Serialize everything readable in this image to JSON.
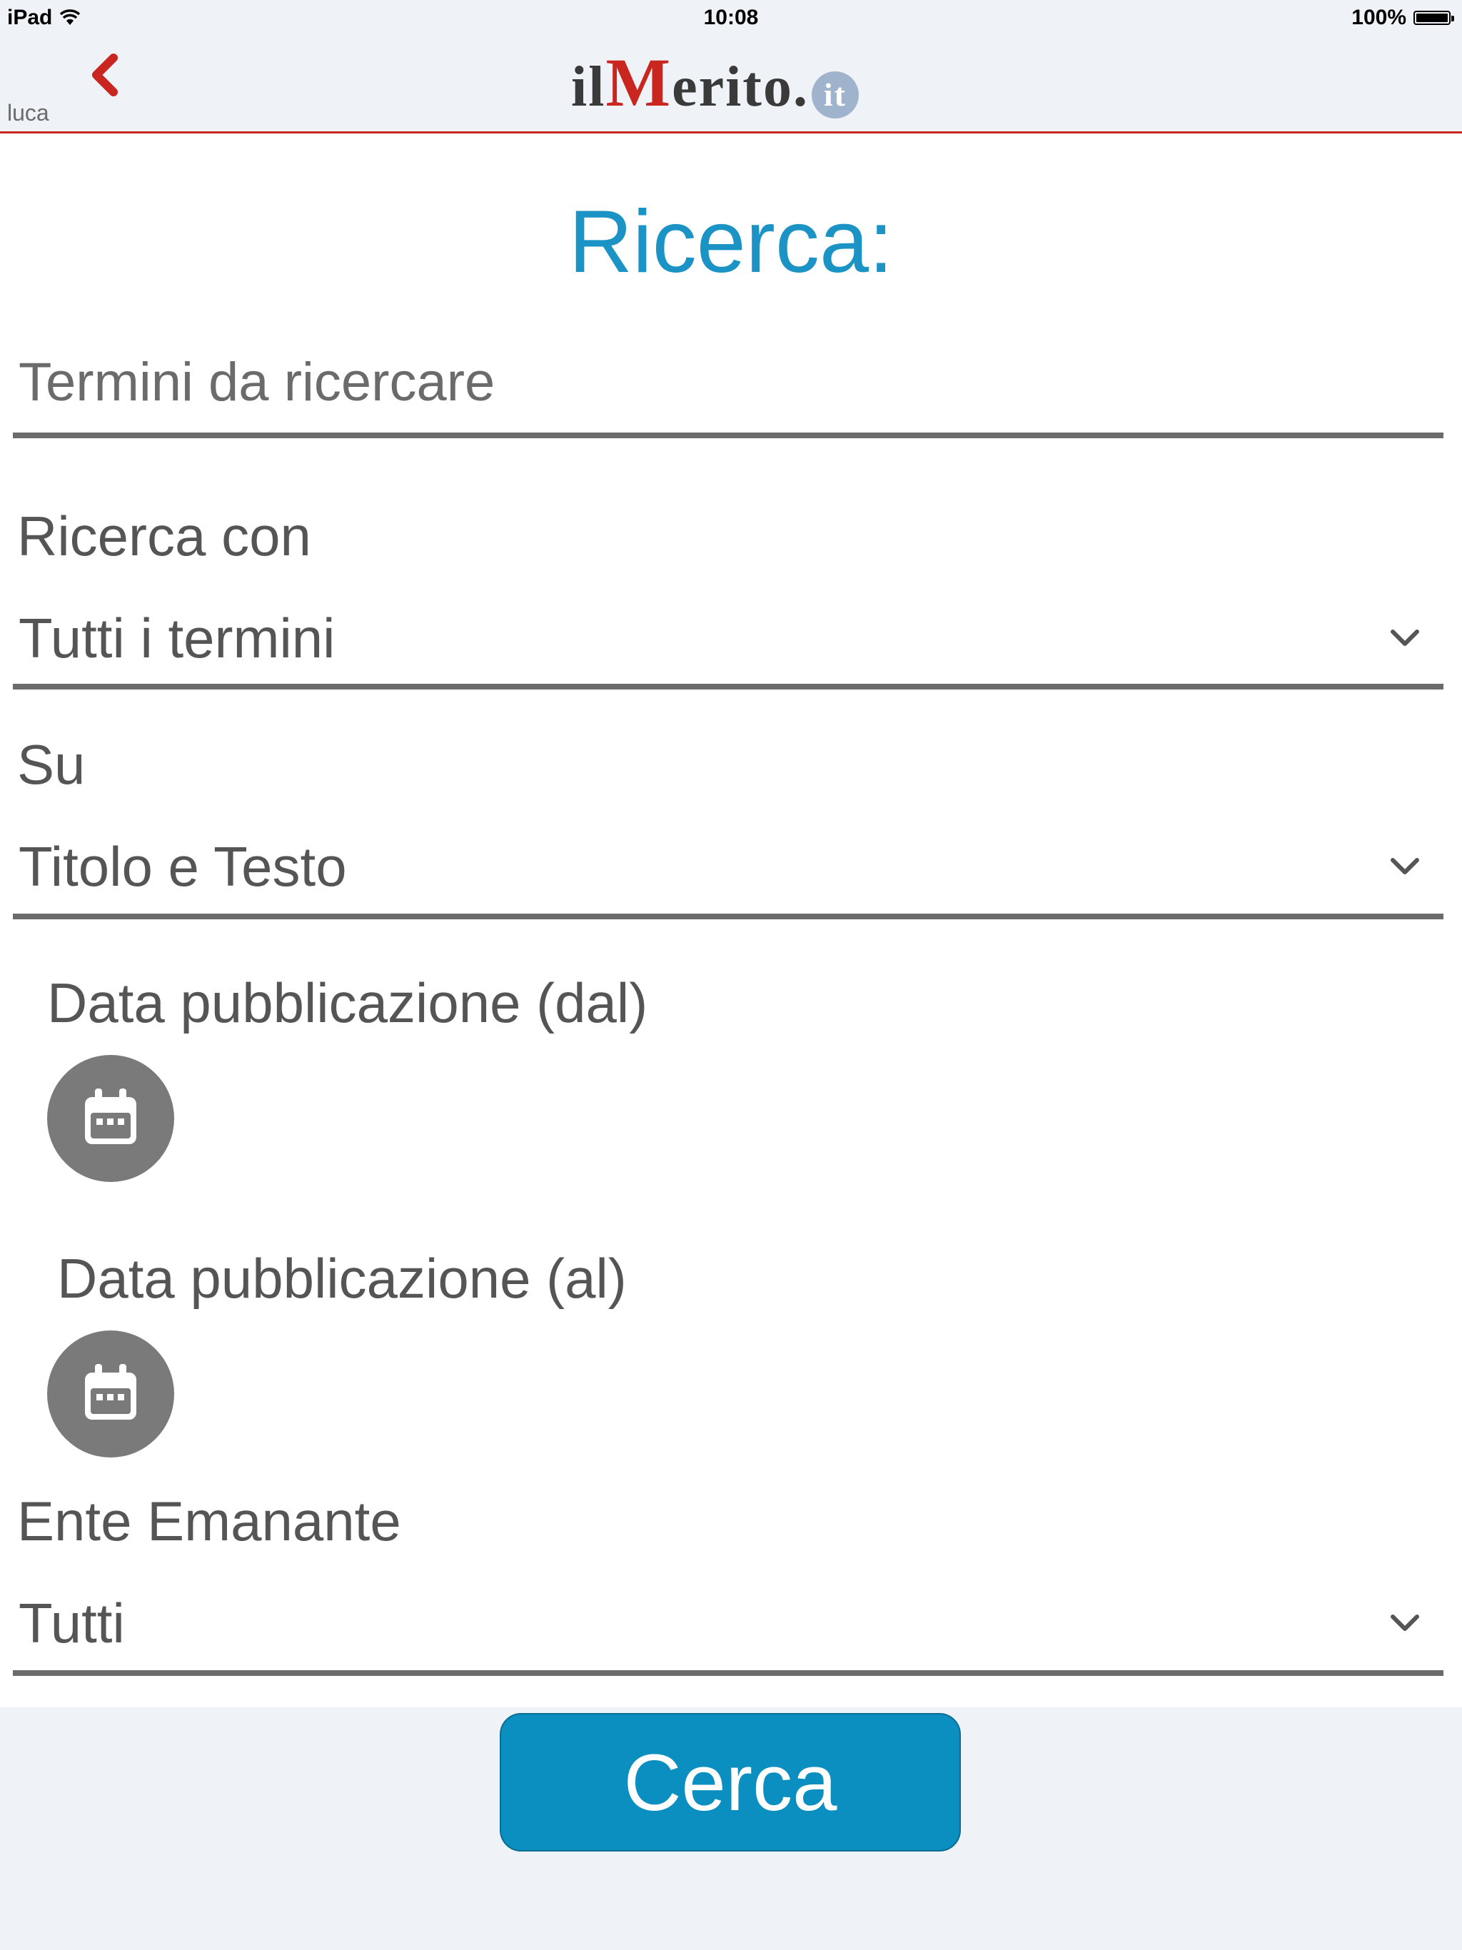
{
  "status_bar": {
    "device": "iPad",
    "time": "10:08",
    "battery": "100%"
  },
  "nav": {
    "user": "luca",
    "logo": {
      "prefix": "il",
      "m": "M",
      "rest": "erito",
      "dot": ".",
      "suffix": "it"
    }
  },
  "page": {
    "title": "Ricerca:"
  },
  "search": {
    "placeholder": "Termini da ricercare"
  },
  "fields": {
    "ricerca_con": {
      "label": "Ricerca con",
      "value": "Tutti i termini"
    },
    "su": {
      "label": "Su",
      "value": "Titolo e Testo"
    },
    "data_dal": {
      "label": "Data pubblicazione (dal)"
    },
    "data_al": {
      "label": "Data pubblicazione (al)"
    },
    "ente": {
      "label": "Ente Emanante",
      "value": "Tutti"
    }
  },
  "actions": {
    "search_label": "Cerca"
  },
  "colors": {
    "accent": "#1b93c4",
    "button": "#0b8fc0",
    "nav_border": "#c8261f",
    "back_arrow": "#c8261f",
    "icons": "#7a7a7a"
  }
}
